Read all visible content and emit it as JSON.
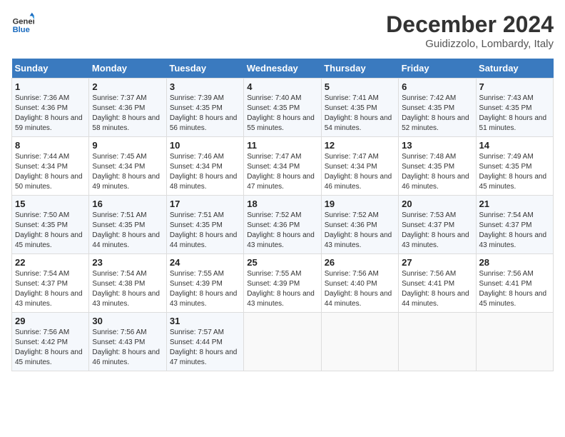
{
  "header": {
    "logo_general": "General",
    "logo_blue": "Blue",
    "month": "December 2024",
    "location": "Guidizzolo, Lombardy, Italy"
  },
  "columns": [
    "Sunday",
    "Monday",
    "Tuesday",
    "Wednesday",
    "Thursday",
    "Friday",
    "Saturday"
  ],
  "weeks": [
    [
      {
        "day": "1",
        "sunrise": "Sunrise: 7:36 AM",
        "sunset": "Sunset: 4:36 PM",
        "daylight": "Daylight: 8 hours and 59 minutes."
      },
      {
        "day": "2",
        "sunrise": "Sunrise: 7:37 AM",
        "sunset": "Sunset: 4:36 PM",
        "daylight": "Daylight: 8 hours and 58 minutes."
      },
      {
        "day": "3",
        "sunrise": "Sunrise: 7:39 AM",
        "sunset": "Sunset: 4:35 PM",
        "daylight": "Daylight: 8 hours and 56 minutes."
      },
      {
        "day": "4",
        "sunrise": "Sunrise: 7:40 AM",
        "sunset": "Sunset: 4:35 PM",
        "daylight": "Daylight: 8 hours and 55 minutes."
      },
      {
        "day": "5",
        "sunrise": "Sunrise: 7:41 AM",
        "sunset": "Sunset: 4:35 PM",
        "daylight": "Daylight: 8 hours and 54 minutes."
      },
      {
        "day": "6",
        "sunrise": "Sunrise: 7:42 AM",
        "sunset": "Sunset: 4:35 PM",
        "daylight": "Daylight: 8 hours and 52 minutes."
      },
      {
        "day": "7",
        "sunrise": "Sunrise: 7:43 AM",
        "sunset": "Sunset: 4:35 PM",
        "daylight": "Daylight: 8 hours and 51 minutes."
      }
    ],
    [
      {
        "day": "8",
        "sunrise": "Sunrise: 7:44 AM",
        "sunset": "Sunset: 4:34 PM",
        "daylight": "Daylight: 8 hours and 50 minutes."
      },
      {
        "day": "9",
        "sunrise": "Sunrise: 7:45 AM",
        "sunset": "Sunset: 4:34 PM",
        "daylight": "Daylight: 8 hours and 49 minutes."
      },
      {
        "day": "10",
        "sunrise": "Sunrise: 7:46 AM",
        "sunset": "Sunset: 4:34 PM",
        "daylight": "Daylight: 8 hours and 48 minutes."
      },
      {
        "day": "11",
        "sunrise": "Sunrise: 7:47 AM",
        "sunset": "Sunset: 4:34 PM",
        "daylight": "Daylight: 8 hours and 47 minutes."
      },
      {
        "day": "12",
        "sunrise": "Sunrise: 7:47 AM",
        "sunset": "Sunset: 4:34 PM",
        "daylight": "Daylight: 8 hours and 46 minutes."
      },
      {
        "day": "13",
        "sunrise": "Sunrise: 7:48 AM",
        "sunset": "Sunset: 4:35 PM",
        "daylight": "Daylight: 8 hours and 46 minutes."
      },
      {
        "day": "14",
        "sunrise": "Sunrise: 7:49 AM",
        "sunset": "Sunset: 4:35 PM",
        "daylight": "Daylight: 8 hours and 45 minutes."
      }
    ],
    [
      {
        "day": "15",
        "sunrise": "Sunrise: 7:50 AM",
        "sunset": "Sunset: 4:35 PM",
        "daylight": "Daylight: 8 hours and 45 minutes."
      },
      {
        "day": "16",
        "sunrise": "Sunrise: 7:51 AM",
        "sunset": "Sunset: 4:35 PM",
        "daylight": "Daylight: 8 hours and 44 minutes."
      },
      {
        "day": "17",
        "sunrise": "Sunrise: 7:51 AM",
        "sunset": "Sunset: 4:35 PM",
        "daylight": "Daylight: 8 hours and 44 minutes."
      },
      {
        "day": "18",
        "sunrise": "Sunrise: 7:52 AM",
        "sunset": "Sunset: 4:36 PM",
        "daylight": "Daylight: 8 hours and 43 minutes."
      },
      {
        "day": "19",
        "sunrise": "Sunrise: 7:52 AM",
        "sunset": "Sunset: 4:36 PM",
        "daylight": "Daylight: 8 hours and 43 minutes."
      },
      {
        "day": "20",
        "sunrise": "Sunrise: 7:53 AM",
        "sunset": "Sunset: 4:37 PM",
        "daylight": "Daylight: 8 hours and 43 minutes."
      },
      {
        "day": "21",
        "sunrise": "Sunrise: 7:54 AM",
        "sunset": "Sunset: 4:37 PM",
        "daylight": "Daylight: 8 hours and 43 minutes."
      }
    ],
    [
      {
        "day": "22",
        "sunrise": "Sunrise: 7:54 AM",
        "sunset": "Sunset: 4:37 PM",
        "daylight": "Daylight: 8 hours and 43 minutes."
      },
      {
        "day": "23",
        "sunrise": "Sunrise: 7:54 AM",
        "sunset": "Sunset: 4:38 PM",
        "daylight": "Daylight: 8 hours and 43 minutes."
      },
      {
        "day": "24",
        "sunrise": "Sunrise: 7:55 AM",
        "sunset": "Sunset: 4:39 PM",
        "daylight": "Daylight: 8 hours and 43 minutes."
      },
      {
        "day": "25",
        "sunrise": "Sunrise: 7:55 AM",
        "sunset": "Sunset: 4:39 PM",
        "daylight": "Daylight: 8 hours and 43 minutes."
      },
      {
        "day": "26",
        "sunrise": "Sunrise: 7:56 AM",
        "sunset": "Sunset: 4:40 PM",
        "daylight": "Daylight: 8 hours and 44 minutes."
      },
      {
        "day": "27",
        "sunrise": "Sunrise: 7:56 AM",
        "sunset": "Sunset: 4:41 PM",
        "daylight": "Daylight: 8 hours and 44 minutes."
      },
      {
        "day": "28",
        "sunrise": "Sunrise: 7:56 AM",
        "sunset": "Sunset: 4:41 PM",
        "daylight": "Daylight: 8 hours and 45 minutes."
      }
    ],
    [
      {
        "day": "29",
        "sunrise": "Sunrise: 7:56 AM",
        "sunset": "Sunset: 4:42 PM",
        "daylight": "Daylight: 8 hours and 45 minutes."
      },
      {
        "day": "30",
        "sunrise": "Sunrise: 7:56 AM",
        "sunset": "Sunset: 4:43 PM",
        "daylight": "Daylight: 8 hours and 46 minutes."
      },
      {
        "day": "31",
        "sunrise": "Sunrise: 7:57 AM",
        "sunset": "Sunset: 4:44 PM",
        "daylight": "Daylight: 8 hours and 47 minutes."
      },
      null,
      null,
      null,
      null
    ]
  ]
}
